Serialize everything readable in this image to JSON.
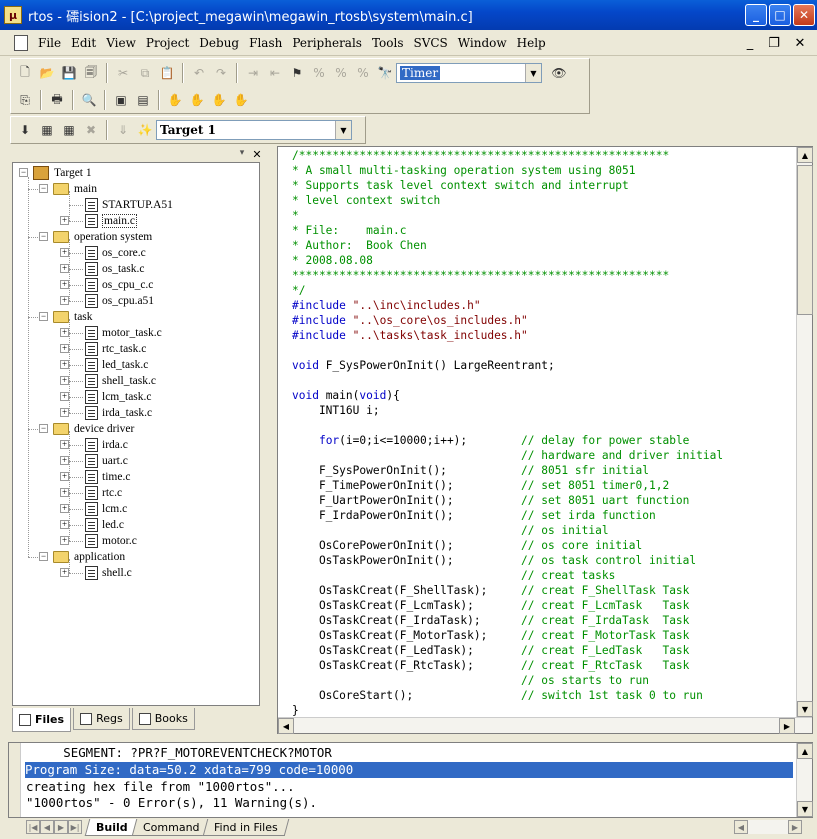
{
  "window": {
    "title": "rtos - 礝ision2 - [C:\\project_megawin\\megawin_rtosb\\system\\main.c]",
    "app_glyph": "μ"
  },
  "menu": [
    "File",
    "Edit",
    "View",
    "Project",
    "Debug",
    "Flash",
    "Peripherals",
    "Tools",
    "SVCS",
    "Window",
    "Help"
  ],
  "toolbar": {
    "find_value": "Timer",
    "target_value": "Target 1"
  },
  "project_tree": {
    "root": "Target 1",
    "groups": [
      {
        "name": "main",
        "files": [
          "STARTUP.A51",
          "main.c"
        ]
      },
      {
        "name": "operation system",
        "files": [
          "os_core.c",
          "os_task.c",
          "os_cpu_c.c",
          "os_cpu.a51"
        ]
      },
      {
        "name": "task",
        "files": [
          "motor_task.c",
          "rtc_task.c",
          "led_task.c",
          "shell_task.c",
          "lcm_task.c",
          "irda_task.c"
        ]
      },
      {
        "name": "device driver",
        "files": [
          "irda.c",
          "uart.c",
          "time.c",
          "rtc.c",
          "lcm.c",
          "led.c",
          "motor.c"
        ]
      },
      {
        "name": "application",
        "files": [
          "shell.c"
        ]
      }
    ]
  },
  "panel_tabs": [
    "Files",
    "Regs",
    "Books"
  ],
  "code_lines": [
    [
      [
        "c",
        "/*******************************************************"
      ]
    ],
    [
      [
        "c",
        "* A small multi-tasking operation system using 8051"
      ]
    ],
    [
      [
        "c",
        "* Supports task level context switch and interrupt"
      ]
    ],
    [
      [
        "c",
        "* level context switch"
      ]
    ],
    [
      [
        "c",
        "*"
      ]
    ],
    [
      [
        "c",
        "* File:    main.c"
      ]
    ],
    [
      [
        "c",
        "* Author:  Book Chen"
      ]
    ],
    [
      [
        "c",
        "* 2008.08.08"
      ]
    ],
    [
      [
        "c",
        "********************************************************"
      ]
    ],
    [
      [
        "c",
        "*/"
      ]
    ],
    [
      [
        "k",
        "#include "
      ],
      [
        "s",
        "\"..\\inc\\includes.h\""
      ]
    ],
    [
      [
        "k",
        "#include "
      ],
      [
        "s",
        "\"..\\os_core\\os_includes.h\""
      ]
    ],
    [
      [
        "k",
        "#include "
      ],
      [
        "s",
        "\"..\\tasks\\task_includes.h\""
      ]
    ],
    [
      [
        "n",
        ""
      ]
    ],
    [
      [
        "k",
        "void"
      ],
      [
        "n",
        " F_SysPowerOnInit() LargeReentrant;"
      ]
    ],
    [
      [
        "n",
        ""
      ]
    ],
    [
      [
        "k",
        "void"
      ],
      [
        "n",
        " main("
      ],
      [
        "k",
        "void"
      ],
      [
        "n",
        "){"
      ]
    ],
    [
      [
        "n",
        "    INT16U i;"
      ]
    ],
    [
      [
        "n",
        ""
      ]
    ],
    [
      [
        "n",
        "    "
      ],
      [
        "k",
        "for"
      ],
      [
        "n",
        "(i=0;i<=10000;i++);        "
      ],
      [
        "c",
        "// delay for power stable"
      ]
    ],
    [
      [
        "n",
        "                                  "
      ],
      [
        "c",
        "// hardware and driver initial"
      ]
    ],
    [
      [
        "n",
        "    F_SysPowerOnInit();           "
      ],
      [
        "c",
        "// 8051 sfr initial"
      ]
    ],
    [
      [
        "n",
        "    F_TimePowerOnInit();          "
      ],
      [
        "c",
        "// set 8051 timer0,1,2"
      ]
    ],
    [
      [
        "n",
        "    F_UartPowerOnInit();          "
      ],
      [
        "c",
        "// set 8051 uart function"
      ]
    ],
    [
      [
        "n",
        "    F_IrdaPowerOnInit();          "
      ],
      [
        "c",
        "// set irda function"
      ]
    ],
    [
      [
        "n",
        "                                  "
      ],
      [
        "c",
        "// os initial"
      ]
    ],
    [
      [
        "n",
        "    OsCorePowerOnInit();          "
      ],
      [
        "c",
        "// os core initial"
      ]
    ],
    [
      [
        "n",
        "    OsTaskPowerOnInit();          "
      ],
      [
        "c",
        "// os task control initial"
      ]
    ],
    [
      [
        "n",
        "                                  "
      ],
      [
        "c",
        "// creat tasks"
      ]
    ],
    [
      [
        "n",
        "    OsTaskCreat(F_ShellTask);     "
      ],
      [
        "c",
        "// creat F_ShellTask Task"
      ]
    ],
    [
      [
        "n",
        "    OsTaskCreat(F_LcmTask);       "
      ],
      [
        "c",
        "// creat F_LcmTask   Task"
      ]
    ],
    [
      [
        "n",
        "    OsTaskCreat(F_IrdaTask);      "
      ],
      [
        "c",
        "// creat F_IrdaTask  Task"
      ]
    ],
    [
      [
        "n",
        "    OsTaskCreat(F_MotorTask);     "
      ],
      [
        "c",
        "// creat F_MotorTask Task"
      ]
    ],
    [
      [
        "n",
        "    OsTaskCreat(F_LedTask);       "
      ],
      [
        "c",
        "// creat F_LedTask   Task"
      ]
    ],
    [
      [
        "n",
        "    OsTaskCreat(F_RtcTask);       "
      ],
      [
        "c",
        "// creat F_RtcTask   Task"
      ]
    ],
    [
      [
        "n",
        "                                  "
      ],
      [
        "c",
        "// os starts to run"
      ]
    ],
    [
      [
        "n",
        "    OsCoreStart();                "
      ],
      [
        "c",
        "// switch 1st task 0 to run"
      ]
    ],
    [
      [
        "n",
        "}"
      ]
    ]
  ],
  "output_lines": [
    "     SEGMENT: ?PR?F_MOTOREVENTCHECK?MOTOR",
    "Program Size: data=50.2 xdata=799 code=10000",
    "creating hex file from \"1000rtos\"...",
    "\"1000rtos\" - 0 Error(s), 11 Warning(s)."
  ],
  "output_tabs": [
    "Build",
    "Command",
    "Find in Files"
  ]
}
